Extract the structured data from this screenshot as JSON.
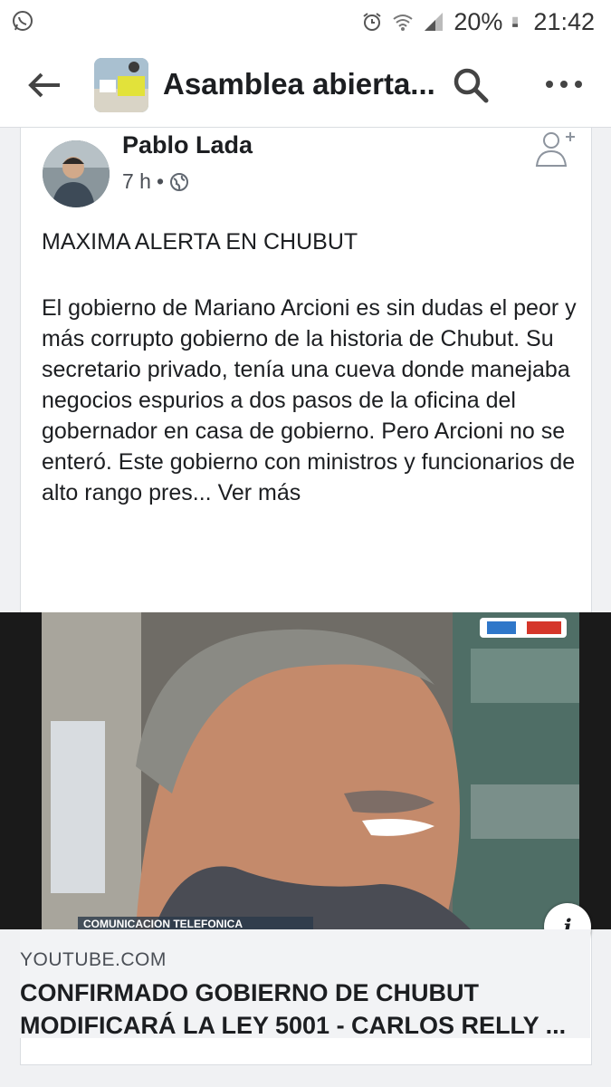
{
  "status_bar": {
    "battery": "20%",
    "time": "21:42",
    "icons": [
      "whatsapp-icon",
      "alarm-icon",
      "wifi-icon",
      "signal-icon",
      "battery-icon"
    ]
  },
  "app_bar": {
    "title": "Asamblea abierta...",
    "icons": [
      "back-arrow-icon",
      "group-thumbnail",
      "search-icon",
      "more-icon"
    ]
  },
  "post": {
    "author": "Pablo Lada",
    "time": "7 h",
    "separator": "•",
    "headline": "MAXIMA ALERTA EN CHUBUT",
    "body": "El gobierno de Mariano Arcioni es sin dudas el peor y más corrupto gobierno de la historia de Chubut. Su secretario privado, tenía una cueva donde manejaba negocios espurios a dos pasos de la  oficina del gobernador en casa de gobierno. Pero Arcioni no se enteró. Este gobierno con ministros y funcionarios de alto rango pres...",
    "see_more": "Ver más"
  },
  "link_preview": {
    "domain": "YOUTUBE.COM",
    "title": "CONFIRMADO GOBIERNO DE CHUBUT MODIFICARÁ LA LEY 5001 - CARLOS RELLY ...",
    "info_label": "i",
    "image_caption": "COMUNICACION TELEFONICA"
  },
  "colors": {
    "background": "#f0f1f3",
    "card": "#ffffff",
    "text": "#1c1e21",
    "secondary_text": "#4b4f56"
  }
}
